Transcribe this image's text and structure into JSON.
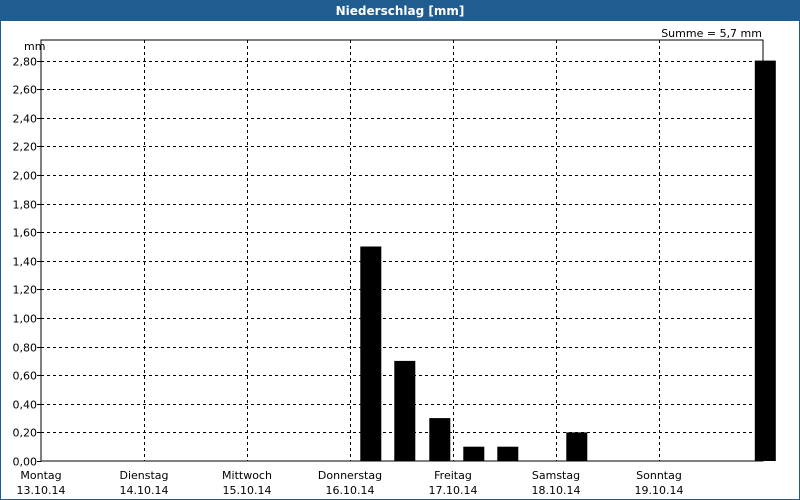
{
  "title": "Niederschlag [mm]",
  "sum_label": "Summe = 5,7 mm",
  "chart_data": {
    "type": "bar",
    "title": "Niederschlag [mm]",
    "ylabel": "mm",
    "ylim": [
      0,
      2.9
    ],
    "yticks": [
      "0,00",
      "0,20",
      "0,40",
      "0,60",
      "0,80",
      "1,00",
      "1,20",
      "1,40",
      "1,60",
      "1,80",
      "2,00",
      "2,20",
      "2,40",
      "2,60",
      "2,80"
    ],
    "grid": true,
    "days": [
      {
        "name": "Montag",
        "date": "13.10.14"
      },
      {
        "name": "Dienstag",
        "date": "14.10.14"
      },
      {
        "name": "Mittwoch",
        "date": "15.10.14"
      },
      {
        "name": "Donnerstag",
        "date": "16.10.14"
      },
      {
        "name": "Freitag",
        "date": "17.10.14"
      },
      {
        "name": "Samstag",
        "date": "18.10.14"
      },
      {
        "name": "Sonntag",
        "date": "19.10.14"
      }
    ],
    "bars": [
      {
        "day_offset": 3.1,
        "value": 1.5
      },
      {
        "day_offset": 3.43,
        "value": 0.7
      },
      {
        "day_offset": 3.77,
        "value": 0.3
      },
      {
        "day_offset": 4.1,
        "value": 0.1
      },
      {
        "day_offset": 4.43,
        "value": 0.1
      },
      {
        "day_offset": 5.1,
        "value": 0.2
      },
      {
        "day_offset": 6.93,
        "value": 2.8
      }
    ],
    "colors": {
      "bar": "#000000",
      "title_bar": "#1f5c8f"
    }
  }
}
